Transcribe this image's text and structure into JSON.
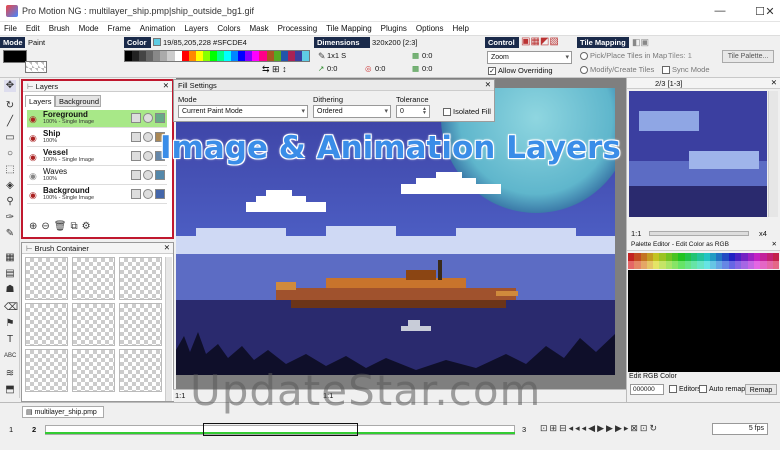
{
  "window": {
    "title": "Pro Motion NG : multilayer_ship.pmp|ship_outside_bg1.gif",
    "minimize": "—",
    "maximize": "☐",
    "close": "✕"
  },
  "menu": [
    "File",
    "Edit",
    "Brush",
    "Mode",
    "Frame",
    "Animation",
    "Layers",
    "Colors",
    "Mask",
    "Processing",
    "Tile Mapping",
    "Plugins",
    "Options",
    "Help"
  ],
  "toolbar": {
    "mode_header": "Mode",
    "mode_value": "Paint",
    "color_header": "Color",
    "color_value": "19/85,205,228 #SFCDE4",
    "dimensions_header": "Dimensions",
    "dimensions_value": "320x200 [2:3]",
    "scale_value": "1x1 S",
    "coord_a": "0:0",
    "coord_b": "0:0",
    "coord_c": "0:0",
    "coord_d": "0:0",
    "control_header": "Control",
    "control_select": "Zoom",
    "allow_overriding": "Allow Overriding",
    "tilemap_header": "Tile Mapping",
    "pick_place": "Pick/Place Tiles in Map",
    "tiles_count": "Tiles: 1",
    "tile_palette": "Tile Palette...",
    "modify_create": "Modify/Create Tiles",
    "sync_mode": "Sync Mode"
  },
  "layers_panel": {
    "title": "Layers",
    "tab_layers": "Layers",
    "tab_background": "Background",
    "rows": [
      {
        "name": "Foreground",
        "sub": "100% - Single Image"
      },
      {
        "name": "Ship",
        "sub": "100%"
      },
      {
        "name": "Vessel",
        "sub": "100% - Single Image"
      },
      {
        "name": "Waves",
        "sub": "100%"
      },
      {
        "name": "Background",
        "sub": "100% - Single Image"
      }
    ]
  },
  "brush_panel": {
    "title": "Brush Container"
  },
  "fill_settings": {
    "title": "Fill Settings",
    "mode_label": "Mode",
    "mode_value": "Current Paint Mode",
    "dithering_label": "Dithering",
    "dithering_value": "Ordered",
    "tolerance_label": "Tolerance",
    "tolerance_value": "0",
    "isolated_fill": "Isolated Fill"
  },
  "preview_panel": {
    "frame_label": "2/3 [1-3]",
    "left_label": "1:1",
    "right_label": "x4"
  },
  "palette_panel": {
    "title": "Palette Editor - Edit Color as RGB",
    "edit_rgb": "Edit RGB Color",
    "hex_value": "000000",
    "editors": "Editors",
    "auto_remap": "Auto remap",
    "remap": "Remap"
  },
  "canvas": {
    "zoom_left": "1:1",
    "zoom_right": "1:1"
  },
  "tabs": {
    "file_tab": "multilayer_ship.pmp"
  },
  "timeline": {
    "frame_start": "1",
    "frame_current": "2",
    "frame_end": "3",
    "fps": "5 fps"
  },
  "overlay_caption": "Image & Animation Layers",
  "watermark": "UpdateStar.com",
  "colors": {
    "header_bg": "#1a2a4a",
    "highlight_red": "#c0182e",
    "sky_top": "#3b3fa0",
    "sky_mid": "#4f62c8",
    "water": "#2a2a6e"
  }
}
